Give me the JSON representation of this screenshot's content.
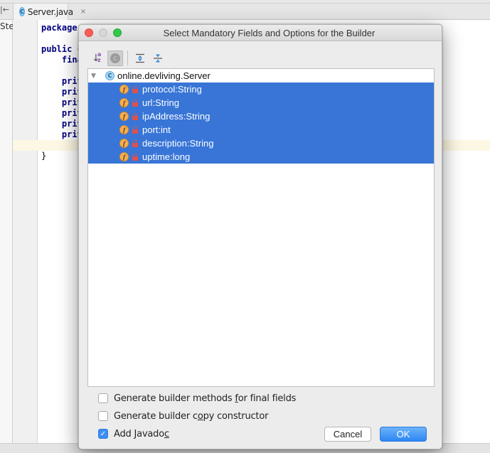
{
  "ide": {
    "tab": {
      "icon": "class-icon",
      "icon_letter": "C",
      "label": "Server.java",
      "close": "×"
    },
    "left_panel_text": "Ste",
    "pin_glyph": "|←",
    "code_lines": [
      {
        "text": "package",
        "kind": "keyword"
      },
      {
        "text": "",
        "kind": "plain"
      },
      {
        "text": "public c",
        "kind": "keyword"
      },
      {
        "text": "    fina",
        "kind": "keyword"
      },
      {
        "text": "",
        "kind": "plain"
      },
      {
        "text": "    priv",
        "kind": "keyword"
      },
      {
        "text": "    priv",
        "kind": "keyword"
      },
      {
        "text": "    priv",
        "kind": "keyword"
      },
      {
        "text": "    priv",
        "kind": "keyword"
      },
      {
        "text": "    priv",
        "kind": "keyword"
      },
      {
        "text": "    priv",
        "kind": "keyword"
      },
      {
        "text": "",
        "kind": "plain"
      },
      {
        "text": "}",
        "kind": "plain"
      }
    ]
  },
  "dialog": {
    "title": "Select Mandatory Fields and Options for the Builder",
    "toolbar": {
      "sort_alpha": "sort-alphabetically-icon",
      "show_classes": "show-classes-icon",
      "expand_all": "expand-all-icon",
      "collapse_all": "collapse-all-icon",
      "class_letter": "C"
    },
    "tree": {
      "root": {
        "icon_letter": "C",
        "label": "online.devliving.Server",
        "expanded": true
      },
      "fields": [
        {
          "icon_letter": "f",
          "label": "protocol:String",
          "selected": true
        },
        {
          "icon_letter": "f",
          "label": "url:String",
          "selected": true
        },
        {
          "icon_letter": "f",
          "label": "ipAddress:String",
          "selected": true
        },
        {
          "icon_letter": "f",
          "label": "port:int",
          "selected": true
        },
        {
          "icon_letter": "f",
          "label": "description:String",
          "selected": true
        },
        {
          "icon_letter": "f",
          "label": "uptime:long",
          "selected": true
        }
      ]
    },
    "options": [
      {
        "pre": "Generate builder methods ",
        "mnemonic": "f",
        "post": "or final fields",
        "checked": false
      },
      {
        "pre": "Generate builder c",
        "mnemonic": "o",
        "post": "py constructor",
        "checked": false
      },
      {
        "pre": "Add Javado",
        "mnemonic": "c",
        "post": "",
        "checked": true
      }
    ],
    "checkmark": "✓",
    "buttons": {
      "cancel": "Cancel",
      "ok": "OK"
    }
  },
  "colors": {
    "selection": "#3875d7",
    "ok_button": "#2d86f3",
    "field_icon": "#f3b055",
    "lock": "#e0504a",
    "caret_line": "#fdf8e3"
  }
}
